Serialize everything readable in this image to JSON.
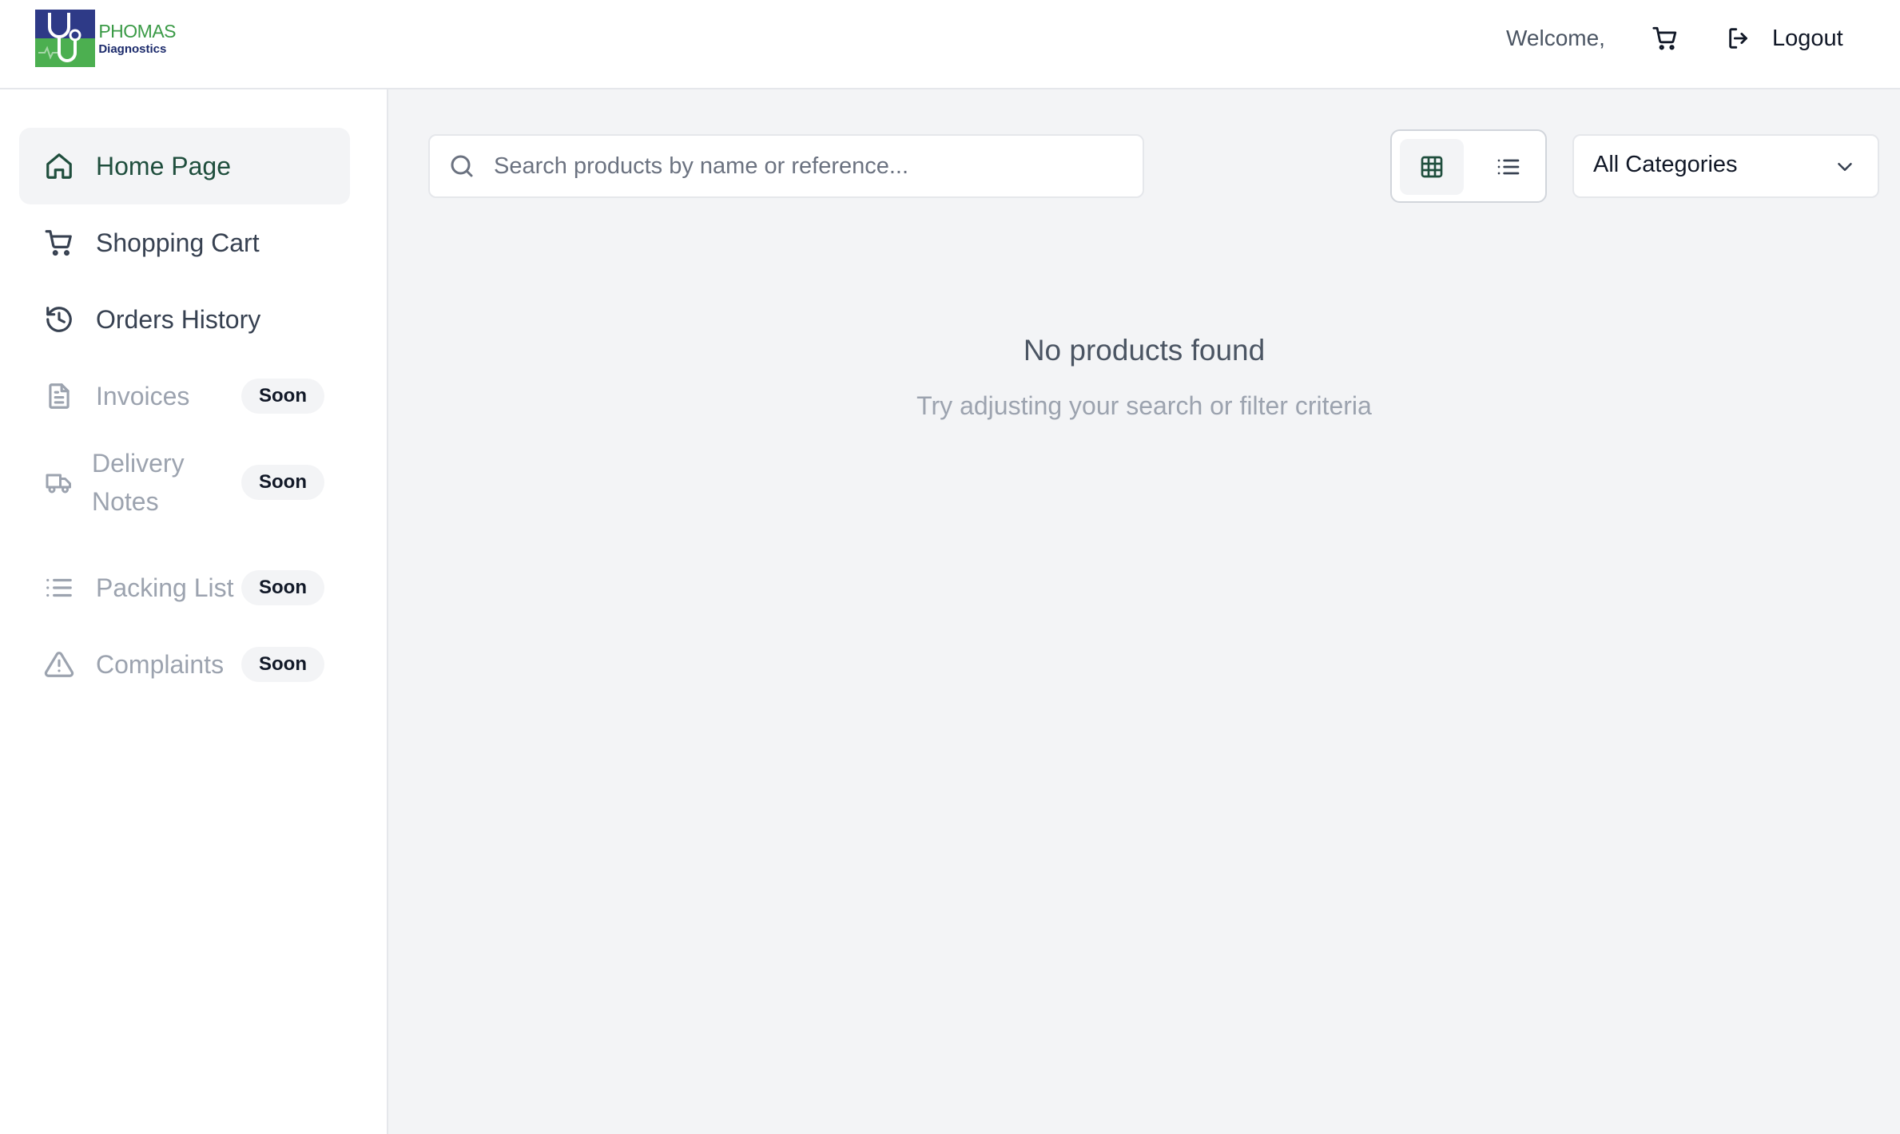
{
  "header": {
    "logo_line1": "PHOMAS",
    "logo_line2": "Diagnostics",
    "welcome": "Welcome,",
    "cart_icon": "shopping-cart-icon",
    "logout_label": "Logout"
  },
  "sidebar": {
    "items": [
      {
        "label": "Home Page",
        "icon": "home-icon",
        "active": true
      },
      {
        "label": "Shopping Cart",
        "icon": "shopping-cart-icon"
      },
      {
        "label": "Orders History",
        "icon": "history-icon"
      },
      {
        "label": "Invoices",
        "icon": "document-icon",
        "badge": "Soon"
      },
      {
        "label": "Delivery Notes",
        "icon": "truck-icon",
        "badge": "Soon"
      },
      {
        "label": "Packing List",
        "icon": "list-icon",
        "badge": "Soon"
      },
      {
        "label": "Complaints",
        "icon": "warning-icon",
        "badge": "Soon"
      }
    ]
  },
  "main": {
    "search": {
      "placeholder": "Search products by name or reference...",
      "value": ""
    },
    "view_toggle": {
      "selected": "grid"
    },
    "category_filter": {
      "selected": "All Categories"
    },
    "empty_state": {
      "title": "No products found",
      "subtitle": "Try adjusting your search or filter criteria"
    }
  },
  "colors": {
    "accent": "#1f4e3d",
    "muted_text": "#9ca3af",
    "background": "#f3f4f6"
  }
}
